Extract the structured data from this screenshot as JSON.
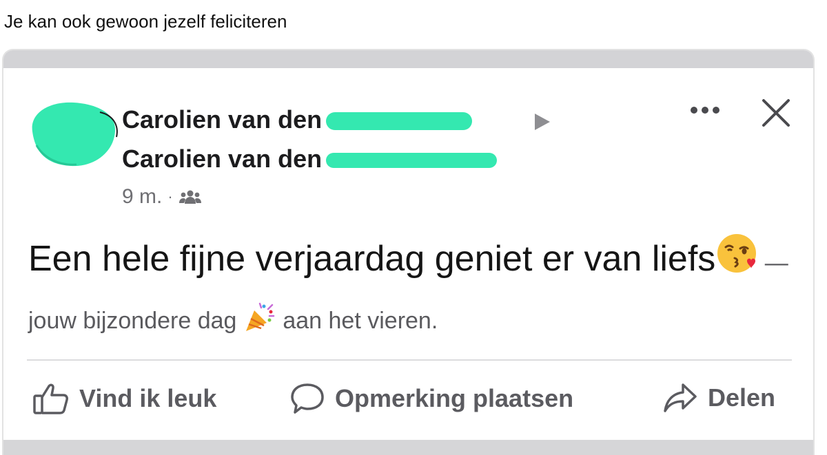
{
  "caption": "Je kan ook gewoon jezelf feliciteren",
  "post": {
    "author_line_1": "Carolien van den",
    "author_line_2": "Carolien van den",
    "time": "9 m.",
    "separator": "·",
    "text": "Een hele fijne verjaardag geniet er van liefs",
    "activity": "— jouw bijzondere dag",
    "activity_end": "aan het vieren."
  },
  "actions": {
    "like": "Vind ik leuk",
    "comment": "Opmerking plaatsen",
    "share": "Delen"
  },
  "icons": {
    "audience": "friends-icon",
    "more": "more-options-icon",
    "close": "close-icon",
    "like": "thumbs-up-icon",
    "comment": "comment-bubble-icon",
    "share": "share-arrow-icon"
  },
  "colors": {
    "redaction": "#34e8b0",
    "muted_text": "#6f6f73",
    "action_text": "#5b5b60"
  }
}
